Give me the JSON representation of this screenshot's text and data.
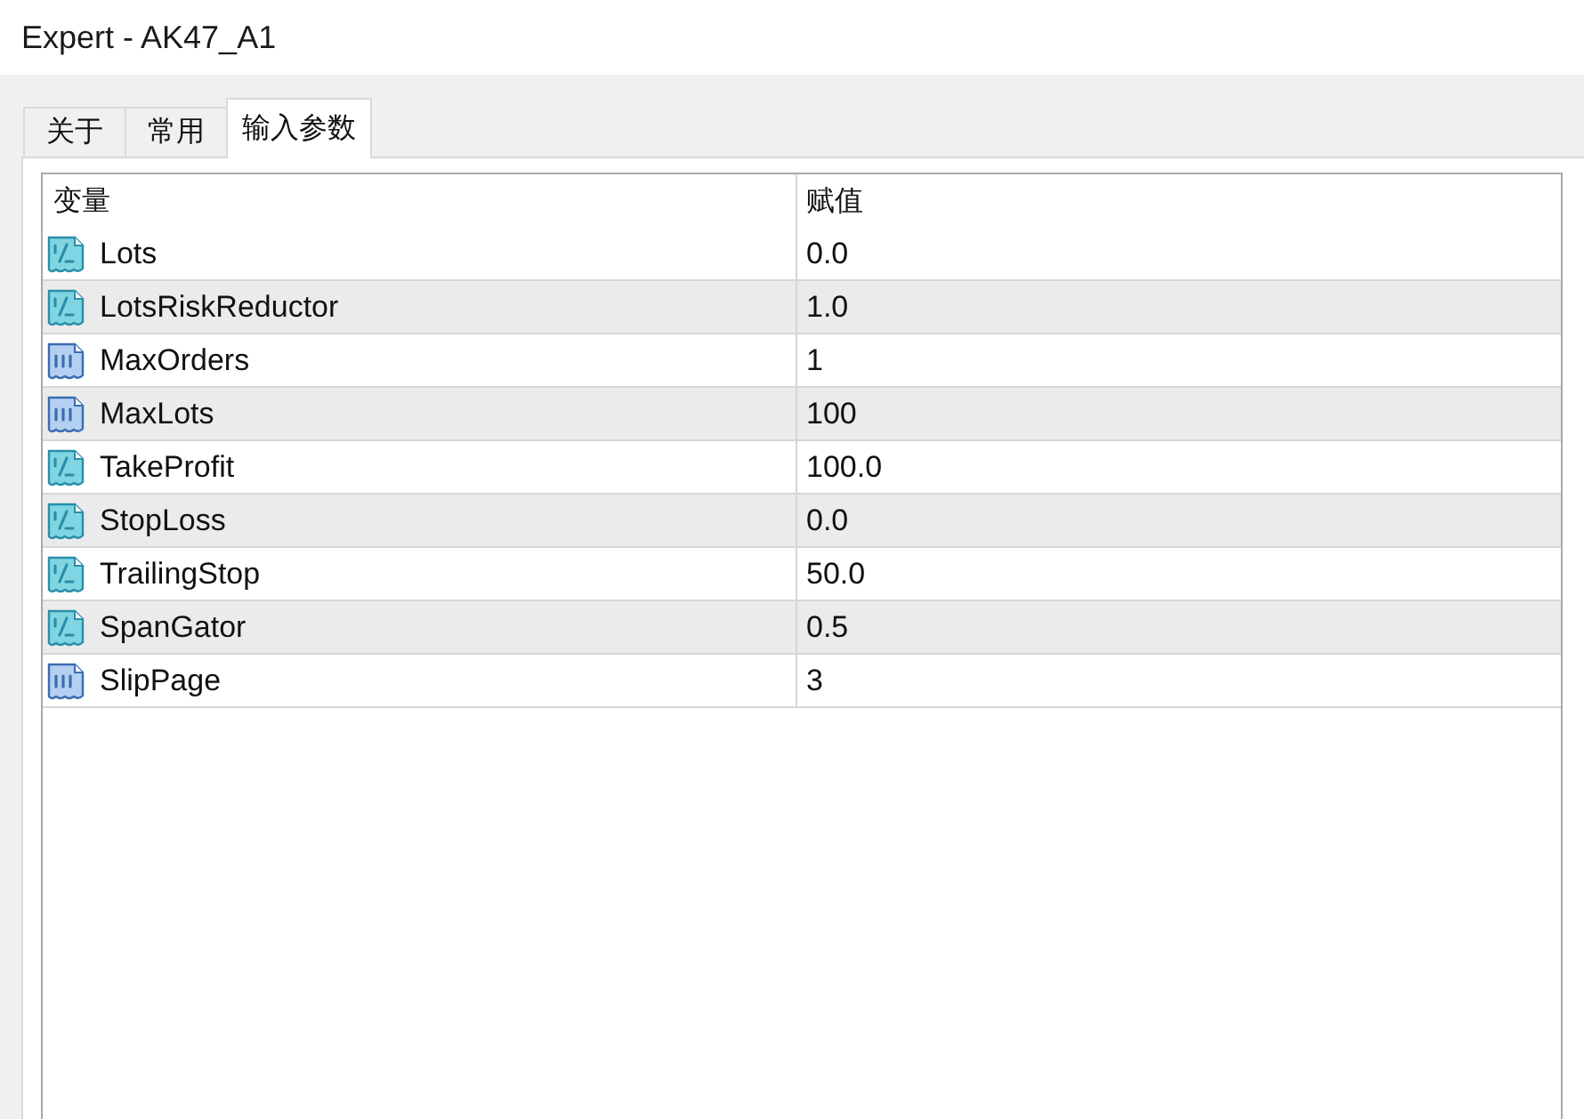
{
  "window": {
    "title": "Expert - AK47_A1"
  },
  "tabs": [
    {
      "label": "关于",
      "selected": false
    },
    {
      "label": "常用",
      "selected": false
    },
    {
      "label": "输入参数",
      "selected": true
    }
  ],
  "table": {
    "columns": [
      "变量",
      "赋值"
    ],
    "rows": [
      {
        "kind": "double",
        "name": "Lots",
        "value": "0.0"
      },
      {
        "kind": "double",
        "name": "LotsRiskReductor",
        "value": "1.0"
      },
      {
        "kind": "int",
        "name": "MaxOrders",
        "value": "1"
      },
      {
        "kind": "int",
        "name": "MaxLots",
        "value": "100"
      },
      {
        "kind": "double",
        "name": "TakeProfit",
        "value": "100.0"
      },
      {
        "kind": "double",
        "name": "StopLoss",
        "value": "0.0"
      },
      {
        "kind": "double",
        "name": "TrailingStop",
        "value": "50.0"
      },
      {
        "kind": "double",
        "name": "SpanGator",
        "value": "0.5"
      },
      {
        "kind": "int",
        "name": "SlipPage",
        "value": "3"
      }
    ]
  }
}
